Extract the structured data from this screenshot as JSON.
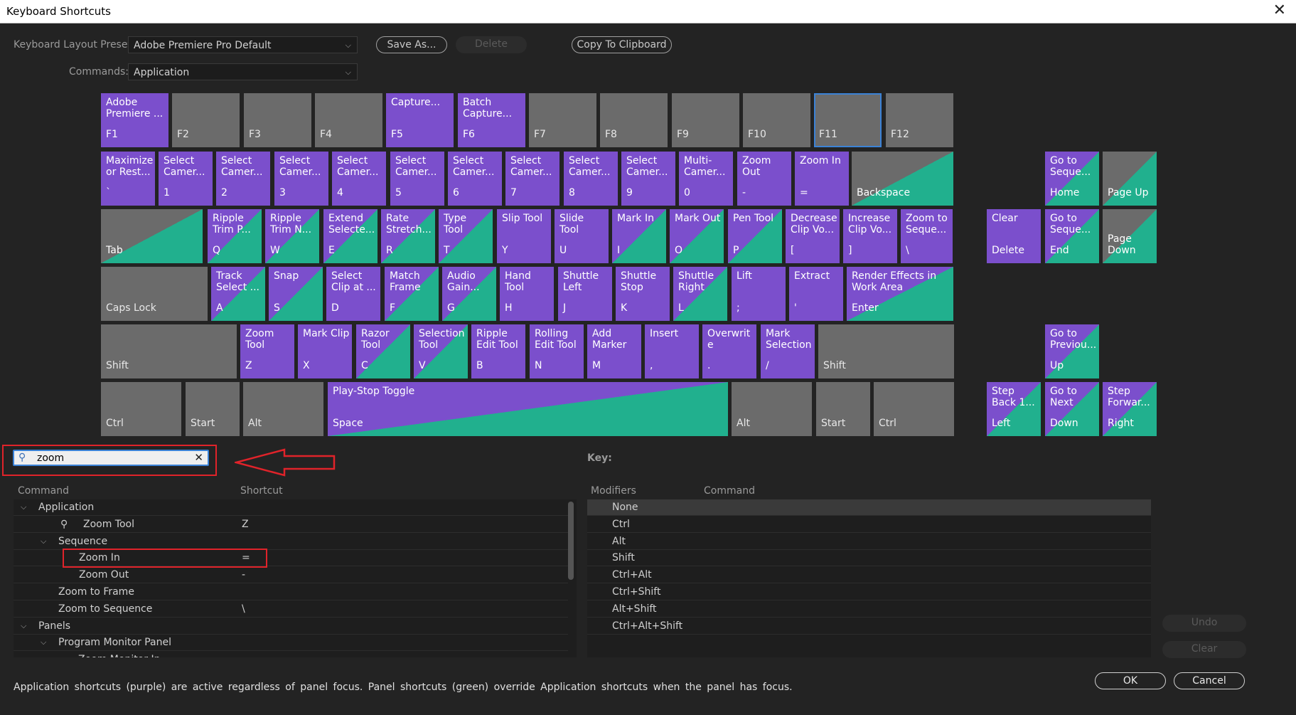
{
  "window": {
    "title": "Keyboard Shortcuts",
    "close_icon": "✕"
  },
  "toolbar": {
    "preset_label": "Keyboard Layout Preset:",
    "preset_value": "Adobe Premiere Pro Default",
    "save_as_label": "Save As...",
    "delete_label": "Delete",
    "copy_label": "Copy To Clipboard",
    "commands_label": "Commands:",
    "commands_value": "Application"
  },
  "colors": {
    "application": "#7b4fcc",
    "panel": "#21b08e",
    "unassigned": "#6b6b6b",
    "selection": "#3b82d6",
    "annotation": "#e0232a"
  },
  "keyboard": [
    {
      "k": "F1",
      "c": "Adobe\nPremiere ...",
      "t": "app"
    },
    {
      "k": "F2",
      "c": "",
      "t": "none"
    },
    {
      "k": "F3",
      "c": "",
      "t": "none"
    },
    {
      "k": "F4",
      "c": "",
      "t": "none"
    },
    {
      "k": "F5",
      "c": "Capture...",
      "t": "app"
    },
    {
      "k": "F6",
      "c": "Batch\nCapture...",
      "t": "app"
    },
    {
      "k": "F7",
      "c": "",
      "t": "none"
    },
    {
      "k": "F8",
      "c": "",
      "t": "none"
    },
    {
      "k": "F9",
      "c": "",
      "t": "none"
    },
    {
      "k": "F10",
      "c": "",
      "t": "none"
    },
    {
      "k": "F11",
      "c": "",
      "t": "none",
      "sel": true
    },
    {
      "k": "F12",
      "c": "",
      "t": "none"
    },
    {
      "k": "`",
      "c": "Maximize\nor Rest...",
      "t": "app"
    },
    {
      "k": "1",
      "c": "Select\nCamer...",
      "t": "app"
    },
    {
      "k": "2",
      "c": "Select\nCamer...",
      "t": "app"
    },
    {
      "k": "3",
      "c": "Select\nCamer...",
      "t": "app"
    },
    {
      "k": "4",
      "c": "Select\nCamer...",
      "t": "app"
    },
    {
      "k": "5",
      "c": "Select\nCamer...",
      "t": "app"
    },
    {
      "k": "6",
      "c": "Select\nCamer...",
      "t": "app"
    },
    {
      "k": "7",
      "c": "Select\nCamer...",
      "t": "app"
    },
    {
      "k": "8",
      "c": "Select\nCamer...",
      "t": "app"
    },
    {
      "k": "9",
      "c": "Select\nCamer...",
      "t": "app"
    },
    {
      "k": "0",
      "c": "Multi-\nCamer...",
      "t": "app"
    },
    {
      "k": "-",
      "c": "Zoom\nOut",
      "t": "app"
    },
    {
      "k": "=",
      "c": "Zoom In",
      "t": "app"
    },
    {
      "k": "Backspace",
      "c": "",
      "t": "half"
    },
    {
      "k": "Tab",
      "c": "",
      "t": "half"
    },
    {
      "k": "Q",
      "c": "Ripple\nTrim P...",
      "t": "both"
    },
    {
      "k": "W",
      "c": "Ripple\nTrim N...",
      "t": "both"
    },
    {
      "k": "E",
      "c": "Extend\nSelecte...",
      "t": "both"
    },
    {
      "k": "R",
      "c": "Rate\nStretch...",
      "t": "both"
    },
    {
      "k": "T",
      "c": "Type\nTool",
      "t": "both"
    },
    {
      "k": "Y",
      "c": "Slip Tool",
      "t": "app"
    },
    {
      "k": "U",
      "c": "Slide\nTool",
      "t": "app"
    },
    {
      "k": "I",
      "c": "Mark In",
      "t": "both"
    },
    {
      "k": "O",
      "c": "Mark Out",
      "t": "both"
    },
    {
      "k": "P",
      "c": "Pen Tool",
      "t": "both"
    },
    {
      "k": "[",
      "c": "Decrease\nClip Vo...",
      "t": "app"
    },
    {
      "k": "]",
      "c": "Increase\nClip Vo...",
      "t": "app"
    },
    {
      "k": "\\",
      "c": "Zoom to\nSeque...",
      "t": "app"
    },
    {
      "k": "Caps Lock",
      "c": "",
      "t": "none"
    },
    {
      "k": "A",
      "c": "Track\nSelect ...",
      "t": "both"
    },
    {
      "k": "S",
      "c": "Snap",
      "t": "both"
    },
    {
      "k": "D",
      "c": "Select\nClip at ...",
      "t": "app"
    },
    {
      "k": "F",
      "c": "Match\nFrame",
      "t": "both"
    },
    {
      "k": "G",
      "c": "Audio\nGain...",
      "t": "both"
    },
    {
      "k": "H",
      "c": "Hand\nTool",
      "t": "app"
    },
    {
      "k": "J",
      "c": "Shuttle\nLeft",
      "t": "app"
    },
    {
      "k": "K",
      "c": "Shuttle\nStop",
      "t": "app"
    },
    {
      "k": "L",
      "c": "Shuttle\nRight",
      "t": "both"
    },
    {
      "k": ";",
      "c": "Lift",
      "t": "app"
    },
    {
      "k": "'",
      "c": "Extract",
      "t": "app"
    },
    {
      "k": "Enter",
      "c": "Render Effects in\nWork Area",
      "t": "both"
    },
    {
      "k": "Shift",
      "c": "",
      "t": "none"
    },
    {
      "k": "Z",
      "c": "Zoom\nTool",
      "t": "app"
    },
    {
      "k": "X",
      "c": "Mark Clip",
      "t": "app"
    },
    {
      "k": "C",
      "c": "Razor\nTool",
      "t": "both"
    },
    {
      "k": "V",
      "c": "Selection\nTool",
      "t": "both"
    },
    {
      "k": "B",
      "c": "Ripple\nEdit Tool",
      "t": "app"
    },
    {
      "k": "N",
      "c": "Rolling\nEdit Tool",
      "t": "app"
    },
    {
      "k": "M",
      "c": "Add\nMarker",
      "t": "app"
    },
    {
      "k": ",",
      "c": "Insert",
      "t": "app"
    },
    {
      "k": ".",
      "c": "Overwrit\ne",
      "t": "app"
    },
    {
      "k": "/",
      "c": "Mark\nSelection",
      "t": "app"
    },
    {
      "k": "Shift",
      "c": "",
      "t": "none"
    },
    {
      "k": "Ctrl",
      "c": "",
      "t": "none"
    },
    {
      "k": "Start",
      "c": "",
      "t": "none"
    },
    {
      "k": "Alt",
      "c": "",
      "t": "none"
    },
    {
      "k": "Space",
      "c": "Play-Stop Toggle",
      "t": "both"
    },
    {
      "k": "Alt",
      "c": "",
      "t": "none"
    },
    {
      "k": "Start",
      "c": "",
      "t": "none"
    },
    {
      "k": "Ctrl",
      "c": "",
      "t": "none"
    },
    {
      "k": "Home",
      "c": "Go to\nSeque...",
      "t": "both"
    },
    {
      "k": "Page Up",
      "c": "",
      "t": "half"
    },
    {
      "k": "Delete",
      "c": "Clear",
      "t": "app"
    },
    {
      "k": "End",
      "c": "Go to\nSeque...",
      "t": "both"
    },
    {
      "k": "Page\nDown",
      "c": "",
      "t": "half"
    },
    {
      "k": "Up",
      "c": "Go to\nPreviou...",
      "t": "both"
    },
    {
      "k": "Left",
      "c": "Step\nBack 1...",
      "t": "both"
    },
    {
      "k": "Down",
      "c": "Go to\nNext",
      "t": "both"
    },
    {
      "k": "Right",
      "c": "Step\nForwar...",
      "t": "both"
    }
  ],
  "search": {
    "value": "zoom",
    "search_icon": "magnifier",
    "clear_icon": "✕"
  },
  "tree": {
    "col_command": "Command",
    "col_shortcut": "Shortcut",
    "rows": [
      {
        "label": "Application",
        "shortcut": "",
        "toggle": "⌵"
      },
      {
        "label": "Zoom Tool",
        "shortcut": "Z",
        "toggle": ""
      },
      {
        "label": "Sequence",
        "shortcut": "",
        "toggle": "⌵"
      },
      {
        "label": "Zoom In",
        "shortcut": "=",
        "toggle": ""
      },
      {
        "label": "Zoom Out",
        "shortcut": "-",
        "toggle": ""
      },
      {
        "label": "Zoom to Frame",
        "shortcut": "",
        "toggle": ""
      },
      {
        "label": "Zoom to Sequence",
        "shortcut": "\\",
        "toggle": ""
      },
      {
        "label": "Panels",
        "shortcut": "",
        "toggle": "⌵"
      },
      {
        "label": "Program Monitor Panel",
        "shortcut": "",
        "toggle": "⌵"
      },
      {
        "label": "Zoom Monitor In",
        "shortcut": "",
        "toggle": ""
      }
    ]
  },
  "key_panel": {
    "title": "Key:",
    "col_modifiers": "Modifiers",
    "col_command": "Command",
    "rows": [
      "None",
      "Ctrl",
      "Alt",
      "Shift",
      "Ctrl+Alt",
      "Ctrl+Shift",
      "Alt+Shift",
      "Ctrl+Alt+Shift"
    ],
    "undo_label": "Undo",
    "clear_label": "Clear"
  },
  "footer": {
    "note": "Application shortcuts (purple) are active regardless of panel focus. Panel shortcuts (green) override Application shortcuts when the panel has focus.",
    "ok_label": "OK",
    "cancel_label": "Cancel"
  }
}
